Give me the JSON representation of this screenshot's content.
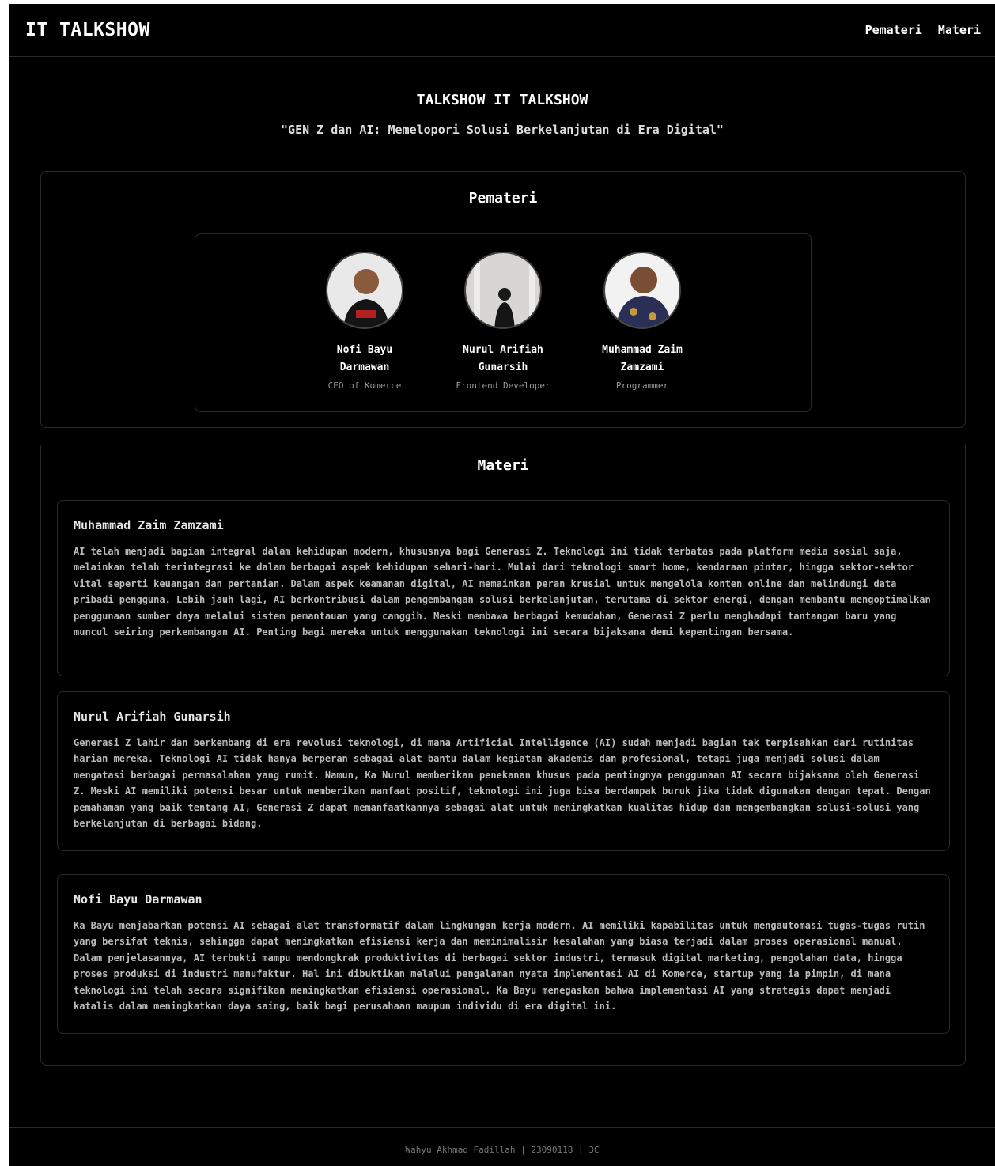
{
  "nav": {
    "brand": "IT TALKSHOW",
    "links": [
      "Pemateri",
      "Materi"
    ]
  },
  "hero": {
    "title": "TALKSHOW IT TALKSHOW",
    "subtitle": "\"GEN Z dan AI: Memelopori Solusi Berkelanjutan di Era Digital\""
  },
  "speakers": {
    "title": "Pemateri",
    "items": [
      {
        "name": "Nofi Bayu Darmawan",
        "role": "CEO of Komerce"
      },
      {
        "name": "Nurul Arifiah Gunarsih",
        "role": "Frontend Developer"
      },
      {
        "name": "Muhammad Zaim Zamzami",
        "role": "Programmer"
      }
    ]
  },
  "materi": {
    "title": "Materi",
    "cards": [
      {
        "name": "Muhammad Zaim Zamzami",
        "text": "AI telah menjadi bagian integral dalam kehidupan modern, khususnya bagi Generasi Z. Teknologi ini tidak terbatas pada platform media sosial saja, melainkan telah terintegrasi ke dalam berbagai aspek kehidupan sehari-hari. Mulai dari teknologi smart home, kendaraan pintar, hingga sektor-sektor vital seperti keuangan dan pertanian. Dalam aspek keamanan digital, AI memainkan peran krusial untuk mengelola konten online dan melindungi data pribadi pengguna. Lebih jauh lagi, AI berkontribusi dalam pengembangan solusi berkelanjutan, terutama di sektor energi, dengan membantu mengoptimalkan penggunaan sumber daya melalui sistem pemantauan yang canggih. Meski membawa berbagai kemudahan, Generasi Z perlu menghadapi tantangan baru yang muncul seiring perkembangan AI. Penting bagi mereka untuk menggunakan teknologi ini secara bijaksana demi kepentingan bersama."
      },
      {
        "name": "Nurul Arifiah Gunarsih",
        "text": "Generasi Z lahir dan berkembang di era revolusi teknologi, di mana Artificial Intelligence (AI) sudah menjadi bagian tak terpisahkan dari rutinitas harian mereka. Teknologi AI tidak hanya berperan sebagai alat bantu dalam kegiatan akademis dan profesional, tetapi juga menjadi solusi dalam mengatasi berbagai permasalahan yang rumit. Namun, Ka Nurul memberikan penekanan khusus pada pentingnya penggunaan AI secara bijaksana oleh Generasi Z. Meski AI memiliki potensi besar untuk memberikan manfaat positif, teknologi ini juga bisa berdampak buruk jika tidak digunakan dengan tepat. Dengan pemahaman yang baik tentang AI, Generasi Z dapat memanfaatkannya sebagai alat untuk meningkatkan kualitas hidup dan mengembangkan solusi-solusi yang berkelanjutan di berbagai bidang."
      },
      {
        "name": "Nofi Bayu Darmawan",
        "text": "Ka Bayu menjabarkan potensi AI sebagai alat transformatif dalam lingkungan kerja modern. AI memiliki kapabilitas untuk mengautomasi tugas-tugas rutin yang bersifat teknis, sehingga dapat meningkatkan efisiensi kerja dan meminimalisir kesalahan yang biasa terjadi dalam proses operasional manual. Dalam penjelasannya, AI terbukti mampu mendongkrak produktivitas di berbagai sektor industri, termasuk digital marketing, pengolahan data, hingga proses produksi di industri manufaktur. Hal ini dibuktikan melalui pengalaman nyata implementasi AI di Komerce, startup yang ia pimpin, di mana teknologi ini telah secara signifikan meningkatkan efisiensi operasional. Ka Bayu menegaskan bahwa implementasi AI yang strategis dapat menjadi katalis dalam meningkatkan daya saing, baik bagi perusahaan maupun individu di era digital ini."
      }
    ]
  },
  "footer": {
    "text": "Wahyu Akhmad Fadillah | 23090118 | 3C"
  }
}
